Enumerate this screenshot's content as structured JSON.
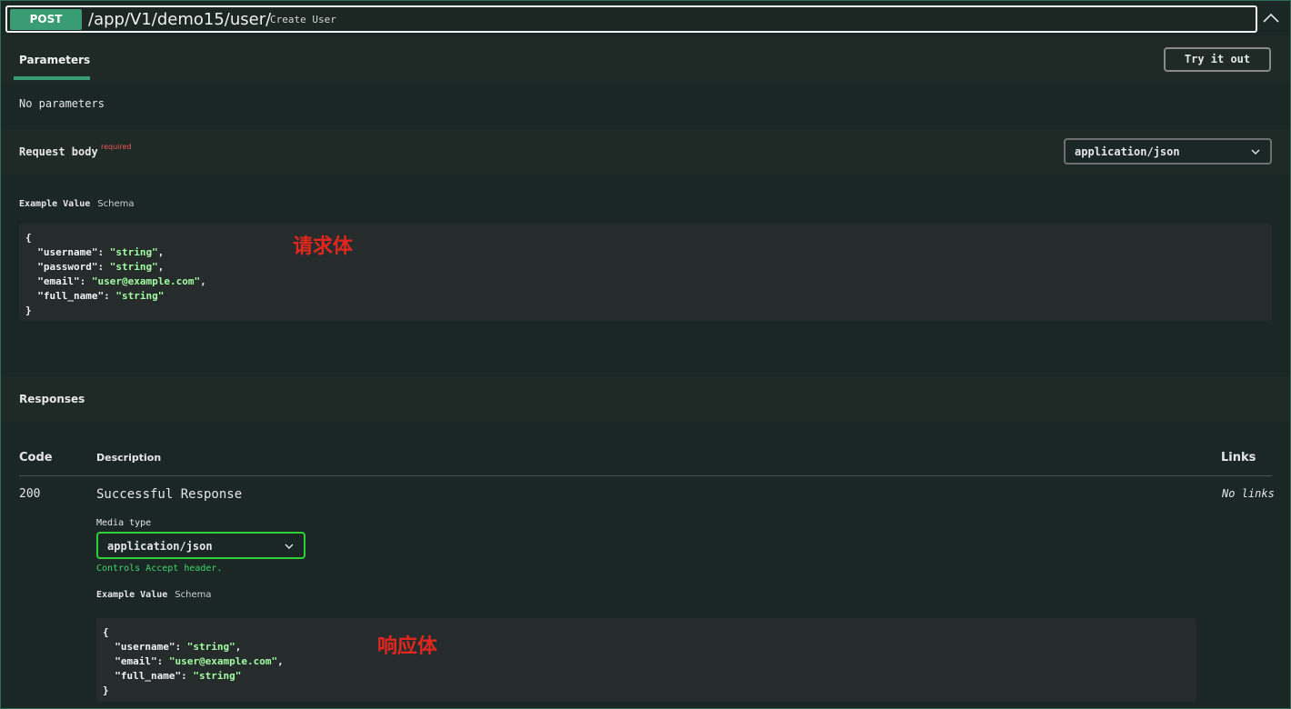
{
  "summary": {
    "method": "POST",
    "path": "/app/V1/demo15/user/",
    "description": "Create User"
  },
  "parameters": {
    "tab_label": "Parameters",
    "try_button": "Try it out",
    "empty_text": "No parameters"
  },
  "request_body": {
    "label": "Request body",
    "required": "required",
    "content_type": "application/json",
    "example_tab": "Example Value",
    "schema_tab": "Schema",
    "annotation": "请求体",
    "example": [
      {
        "key": "username",
        "value": "string"
      },
      {
        "key": "password",
        "value": "string"
      },
      {
        "key": "email",
        "value": "user@example.com"
      },
      {
        "key": "full_name",
        "value": "string"
      }
    ]
  },
  "responses": {
    "title": "Responses",
    "headers": {
      "code": "Code",
      "description": "Description",
      "links": "Links"
    },
    "rows": [
      {
        "code": "200",
        "description": "Successful Response",
        "links": "No links",
        "media_type_label": "Media type",
        "media_type": "application/json",
        "accept_note": "Controls Accept header.",
        "example_tab": "Example Value",
        "schema_tab": "Schema",
        "annotation": "响应体",
        "example": [
          {
            "key": "username",
            "value": "string"
          },
          {
            "key": "email",
            "value": "user@example.com"
          },
          {
            "key": "full_name",
            "value": "string"
          }
        ]
      }
    ]
  },
  "colors": {
    "method_badge": "#3a9c73",
    "string_value": "#a2fca2",
    "required": "#f05555",
    "annotation": "#e0261f",
    "accept_note": "#3fd66e",
    "background": "#1b2724"
  }
}
